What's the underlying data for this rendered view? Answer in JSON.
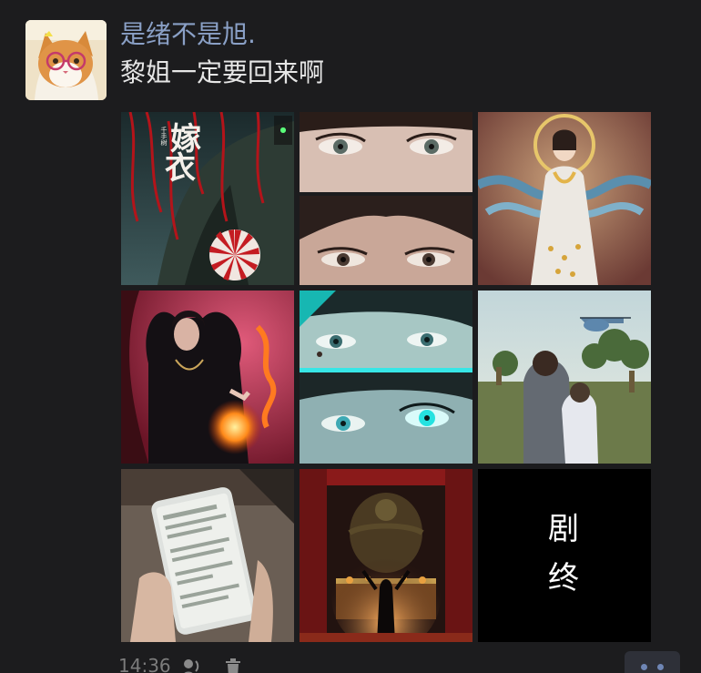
{
  "post": {
    "username": "是绪不是旭.",
    "content": "黎姐一定要回来啊",
    "time": "14:36"
  },
  "images": [
    {
      "id": 1,
      "icon": "poster-red-tree",
      "text_a": "嫁",
      "text_b": "衣",
      "text_c": "千手树"
    },
    {
      "id": 2,
      "icon": "eyes-closeup"
    },
    {
      "id": 3,
      "icon": "goddess-figure"
    },
    {
      "id": 4,
      "icon": "woman-fire"
    },
    {
      "id": 5,
      "icon": "eyes-cyan"
    },
    {
      "id": 6,
      "icon": "helicopter-scene"
    },
    {
      "id": 7,
      "icon": "phone-in-hand"
    },
    {
      "id": 8,
      "icon": "shrine-altar"
    },
    {
      "id": 9,
      "icon": "end-card",
      "text_a": "剧",
      "text_b": "终"
    }
  ],
  "footer": {
    "icons": [
      "voice-icon",
      "delete-icon",
      "more-icon"
    ]
  },
  "colors": {
    "background": "#1c1c1e",
    "username": "#8aa0c6",
    "content": "#e6e6e6",
    "time": "#7c7c7c",
    "more_button": "#2e3038",
    "more_dots": "#6f86b5"
  }
}
